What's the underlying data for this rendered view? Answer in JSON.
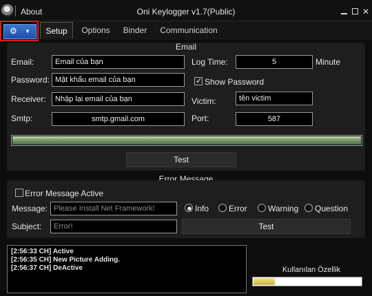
{
  "window": {
    "title": "Oni Keylogger v1.7(Public)",
    "about": "About"
  },
  "tabs": [
    "Setup",
    "Options",
    "Binder",
    "Communication"
  ],
  "email": {
    "section_title": "Email",
    "email_label": "Email:",
    "email_value": "Email của bạn",
    "password_label": "Password:",
    "password_value": "Mật khẩu email của bạn",
    "receiver_label": "Receiver:",
    "receiver_value": "Nhập lại email của bạn",
    "smtp_label": "Smtp:",
    "smtp_value": "smtp.gmail.com",
    "logtime_label": "Log Time:",
    "logtime_value": "5",
    "logtime_unit": "Minute",
    "show_password_label": "Show Password",
    "show_password_checked": true,
    "victim_label": "Victim:",
    "victim_value": "tên victim",
    "port_label": "Port:",
    "port_value": "587",
    "progress_fraction": 1.0,
    "test_label": "Test"
  },
  "error": {
    "section_title": "Error Message",
    "active_label": "Error Message Active",
    "active_checked": false,
    "message_label": "Message:",
    "message_placeholder": "Please Install Net Framework!",
    "subject_label": "Subject:",
    "subject_placeholder": "Error!",
    "types": [
      "Info",
      "Error",
      "Warning",
      "Question"
    ],
    "selected_type": "Info",
    "test_label": "Test"
  },
  "log": [
    "[2:56:33 CH] Active",
    "[2:56:35 CH] New Picture Adding.",
    "[2:56:37 CH] DeActive"
  ],
  "features": {
    "label": "Kullanılan Özellik",
    "progress_fraction": 0.2
  },
  "colors": {
    "accent_red": "#e51a1a",
    "settings_blue": "#2a62c0",
    "panel": "#1e1e1e"
  },
  "icons": {
    "app": "skull-icon",
    "settings": "gear-icon",
    "dropdown": "caret-down-icon"
  }
}
